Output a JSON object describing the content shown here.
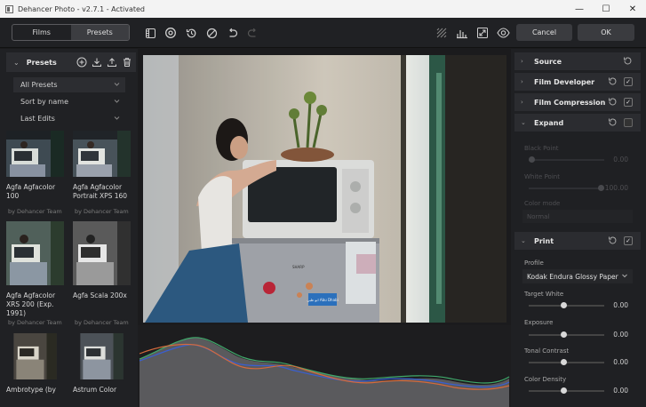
{
  "window": {
    "title": "Dehancer Photo - v2.7.1 - Activated",
    "controls": [
      "—",
      "☐",
      "✕"
    ]
  },
  "toolbar": {
    "tabs": [
      {
        "label": "Films"
      },
      {
        "label": "Presets",
        "active": true
      }
    ],
    "cancel_label": "Cancel",
    "ok_label": "OK"
  },
  "presets": {
    "header": "Presets",
    "filters": [
      "All Presets",
      "Sort by name",
      "Last Edits"
    ],
    "items": [
      {
        "name": "Agfa Agfacolor 100",
        "author": "by Dehancer Team"
      },
      {
        "name": "Agfa Agfacolor Portrait XPS 160",
        "author": "by Dehancer Team"
      },
      {
        "name": "Agfa Agfacolor XRS 200 (Exp. 1991)",
        "author": "by Dehancer Team"
      },
      {
        "name": "Agfa Scala 200x",
        "author": "by Dehancer Team"
      },
      {
        "name": "Ambrotype (by",
        "author": ""
      },
      {
        "name": "Astrum Color",
        "author": ""
      }
    ]
  },
  "panel": {
    "sections": [
      {
        "label": "Source",
        "checkbox": false
      },
      {
        "label": "Film Developer",
        "checked": true
      },
      {
        "label": "Film Compression",
        "checked": true
      },
      {
        "label": "Expand",
        "checked": false
      },
      {
        "label": "Print",
        "checked": true
      }
    ],
    "expand": {
      "black_point": {
        "label": "Black Point",
        "value": "0.00",
        "level": 0.0
      },
      "white_point": {
        "label": "White Point",
        "value": "100.00",
        "level": 1.0
      },
      "color_mode": {
        "label": "Color mode",
        "value": "Normal"
      }
    },
    "print": {
      "profile_label": "Profile",
      "profile_value": "Kodak Endura Glossy Paper",
      "target_white": {
        "label": "Target White",
        "value": "0.00"
      },
      "exposure": {
        "label": "Exposure",
        "value": "0.00"
      },
      "tonal_contrast": {
        "label": "Tonal Contrast",
        "value": "0.00"
      },
      "color_density": {
        "label": "Color Density",
        "value": "0.00"
      }
    }
  },
  "photo": {
    "sticker_text": "ابو ظبي Abu Dhabi",
    "brand_text": "SHARP"
  },
  "colors": {
    "accent": "#3a3b3f",
    "panel": "#2b2c30",
    "bg": "#1b1b1d"
  }
}
